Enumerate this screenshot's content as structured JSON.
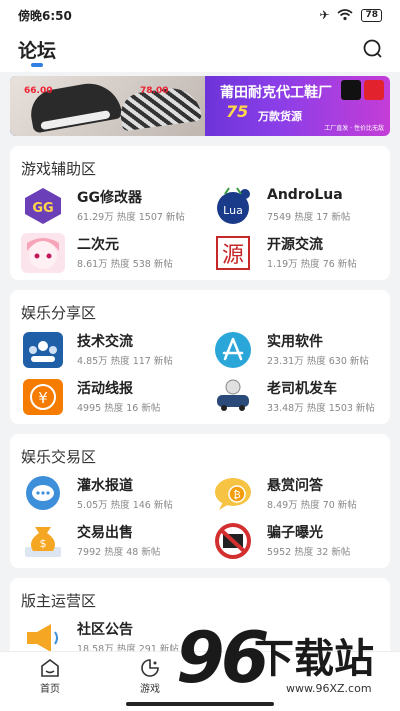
{
  "status": {
    "time": "傍晚6:50",
    "battery": "78"
  },
  "header": {
    "title": "论坛"
  },
  "banner": {
    "price_left": "66.00",
    "price_mid": "78.00",
    "headline": "莆田耐克代工鞋厂",
    "sub_number": "75",
    "sub_text": "万款货源",
    "tagline": "工厂直发 · 性价比无敌"
  },
  "sections": [
    {
      "title": "游戏辅助区",
      "items": [
        {
          "name": "GG修改器",
          "stats": "61.29万 热度  1507 新帖",
          "icon": "gg-icon"
        },
        {
          "name": "AndroLua",
          "stats": "7549 热度  17 新帖",
          "icon": "lua-icon"
        },
        {
          "name": "二次元",
          "stats": "8.61万 热度  538 新帖",
          "icon": "anime-icon"
        },
        {
          "name": "开源交流",
          "stats": "1.19万 热度  76 新帖",
          "icon": "source-icon"
        }
      ]
    },
    {
      "title": "娱乐分享区",
      "items": [
        {
          "name": "技术交流",
          "stats": "4.85万 热度  117 新帖",
          "icon": "tech-icon"
        },
        {
          "name": "实用软件",
          "stats": "23.31万 热度  630 新帖",
          "icon": "app-icon"
        },
        {
          "name": "活动线报",
          "stats": "4995 热度  16 新帖",
          "icon": "yen-icon"
        },
        {
          "name": "老司机发车",
          "stats": "33.48万 热度  1503 新帖",
          "icon": "car-icon"
        }
      ]
    },
    {
      "title": "娱乐交易区",
      "items": [
        {
          "name": "灌水报道",
          "stats": "5.05万 热度  146 新帖",
          "icon": "chat-icon"
        },
        {
          "name": "悬赏问答",
          "stats": "8.49万 热度  70 新帖",
          "icon": "bounty-icon"
        },
        {
          "name": "交易出售",
          "stats": "7992 热度  48 新帖",
          "icon": "money-bag-icon"
        },
        {
          "name": "骗子曝光",
          "stats": "5952 热度  32 新帖",
          "icon": "no-scam-icon"
        }
      ]
    },
    {
      "title": "版主运营区",
      "items": [
        {
          "name": "社区公告",
          "stats": "18.58万 热度  291 新帖",
          "icon": "megaphone-icon"
        },
        {
          "name": "...",
          "stats": "",
          "icon": ""
        }
      ]
    }
  ],
  "tabs": [
    {
      "label": "首页"
    },
    {
      "label": "游戏"
    }
  ],
  "watermark": {
    "number": "96",
    "text": "下载站",
    "url": "www.96XZ.com"
  },
  "colors": {
    "accent": "#2f7fe6"
  }
}
